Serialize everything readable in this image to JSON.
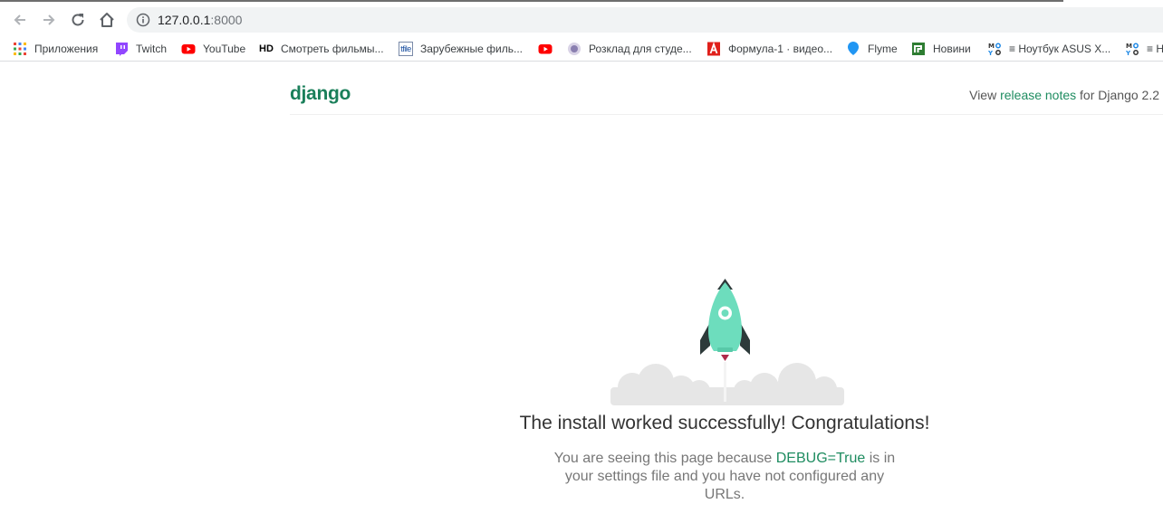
{
  "browser": {
    "url_host": "127.0.0.1",
    "url_port": ":8000",
    "bookmarks": [
      {
        "label": "Приложения",
        "icon": "apps-grid-icon"
      },
      {
        "label": "Twitch",
        "icon": "twitch-icon"
      },
      {
        "label": "YouTube",
        "icon": "youtube-icon"
      },
      {
        "label": "Смотреть фильмы...",
        "icon": "hd-icon",
        "icon_text": "HD"
      },
      {
        "label": "Зарубежные филь...",
        "icon": "tfile-icon",
        "icon_text": "tfile"
      },
      {
        "label": "",
        "icon": "youtube-icon"
      },
      {
        "label": "Розклад для студе...",
        "icon": "university-icon"
      },
      {
        "label": "Формула-1 · видео...",
        "icon": "formula-icon"
      },
      {
        "label": "Flyme",
        "icon": "flyme-icon"
      },
      {
        "label": "Новини",
        "icon": "news-icon"
      },
      {
        "label": "≡ Ноутбук ASUS X...",
        "icon": "mo-icon",
        "icon_text": "Mo"
      },
      {
        "label": "≡ Н",
        "icon": "mo-icon",
        "icon_text": "Mo"
      }
    ]
  },
  "page": {
    "logo": "django",
    "release_prefix": "View ",
    "release_link": "release notes",
    "release_suffix": " for Django 2.2",
    "headline": "The install worked successfully! Congratulations!",
    "desc_prefix": "You are seeing this page because ",
    "desc_link": "DEBUG=True",
    "desc_suffix": " is in your settings file and you have not configured any URLs."
  },
  "colors": {
    "django_green": "#1a7f5a",
    "link_green": "#1e8c60",
    "rocket_body": "#6dddbd",
    "rocket_dark": "#2d3a3a",
    "cloud": "#e8e8e8"
  }
}
